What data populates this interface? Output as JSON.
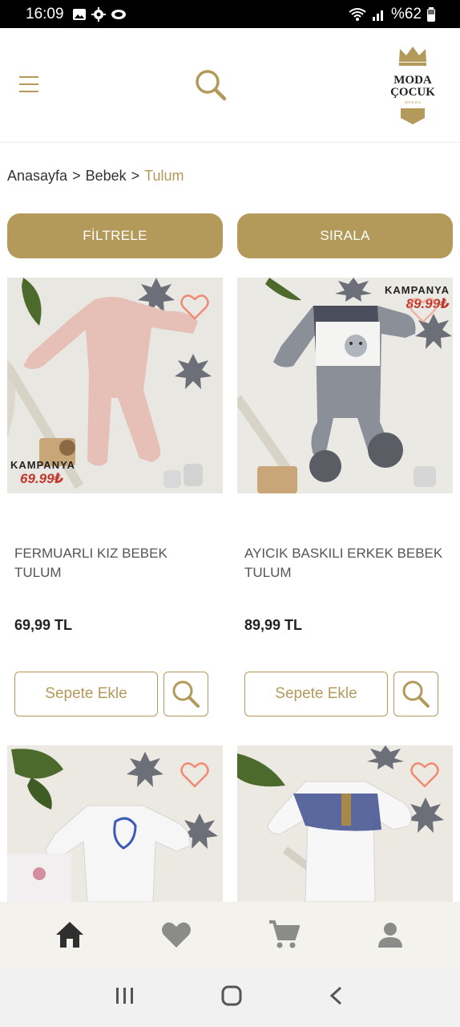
{
  "status_bar": {
    "time": "16:09",
    "battery": "%62",
    "icons": [
      "image-icon",
      "gear-icon",
      "cloud-icon",
      "wifi-icon",
      "signal-icon",
      "battery-icon"
    ]
  },
  "header": {
    "logo_line1": "MODA",
    "logo_line2": "ÇOCUK",
    "logo_since": "SINCE 2012",
    "icons": [
      "menu-icon",
      "search-icon",
      "crown-icon"
    ]
  },
  "breadcrumb": {
    "items": [
      "Anasayfa",
      "Bebek"
    ],
    "separator": ">",
    "current": "Tulum"
  },
  "actions": {
    "filter_label": "FİLTRELE",
    "sort_label": "SIRALA"
  },
  "products": [
    {
      "name": "FERMUARLI KIZ BEBEK TULUM",
      "price": "69,99 TL",
      "badge_title": "KAMPANYA",
      "badge_price": "69.99₺",
      "add_to_cart": "Sepete Ekle"
    },
    {
      "name": "AYICIK BASKILI ERKEK BEBEK TULUM",
      "price": "89,99 TL",
      "badge_title": "KAMPANYA",
      "badge_price": "89.99₺",
      "add_to_cart": "Sepete Ekle"
    },
    {},
    {}
  ],
  "bottom_nav": {
    "items": [
      "home-icon",
      "heart-icon",
      "cart-icon",
      "user-icon"
    ]
  },
  "system_nav": {
    "items": [
      "recent-apps-icon",
      "home-circle-icon",
      "back-icon"
    ]
  },
  "colors": {
    "accent": "#b49a5a",
    "badge_red": "#c3362b",
    "nav_bg": "#f4f2ec"
  }
}
